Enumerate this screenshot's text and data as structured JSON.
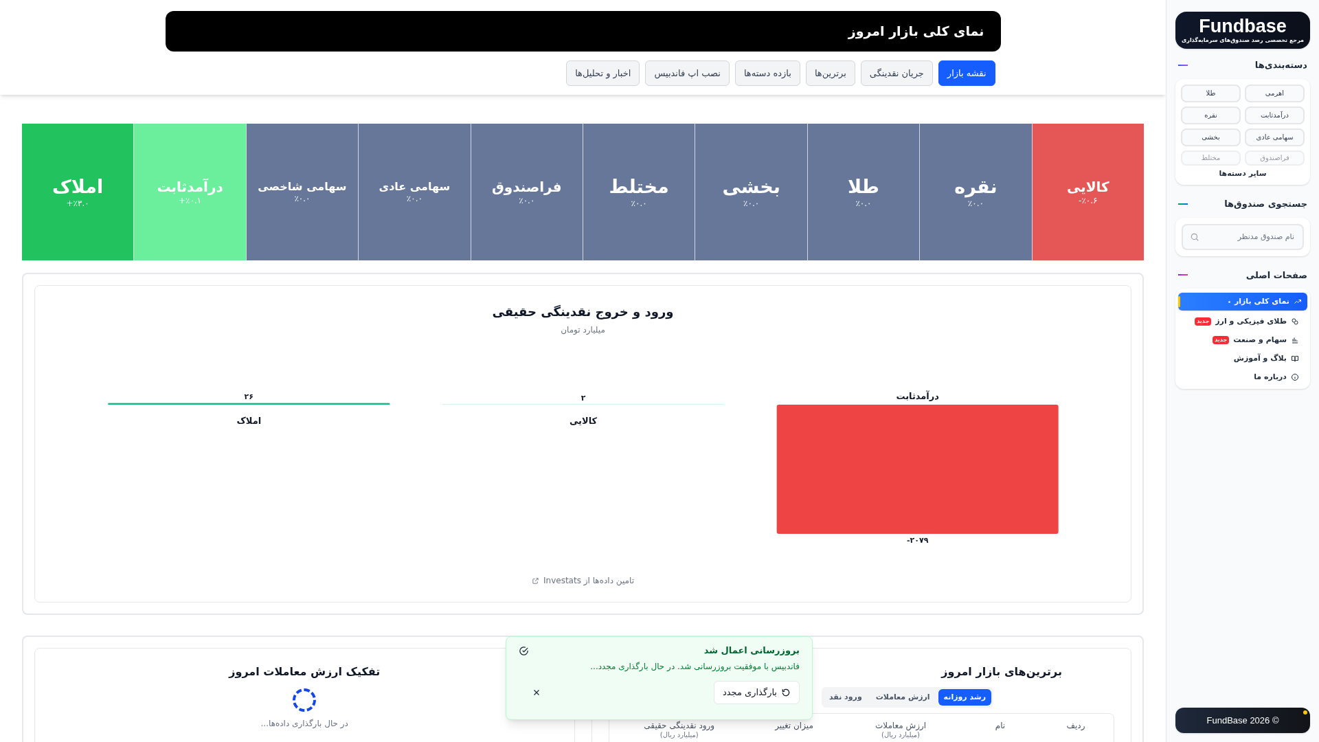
{
  "header": {
    "title": "نمای کلی بازار امروز",
    "tabs": [
      {
        "label": "نقشه بازار",
        "selected": true
      },
      {
        "label": "جریان نقدینگی",
        "selected": false
      },
      {
        "label": "برترین‌ها",
        "selected": false
      },
      {
        "label": "بازده دسته‌ها",
        "selected": false
      },
      {
        "label": "نصب اپ فاندبیس",
        "selected": false
      },
      {
        "label": "اخبار و تحلیل‌ها",
        "selected": false
      }
    ]
  },
  "market_map": [
    {
      "name": "کالایی",
      "change": "-٪۰.۶",
      "color": "#e55757"
    },
    {
      "name": "نقره",
      "change": "٪۰.۰",
      "color": "#667799"
    },
    {
      "name": "طلا",
      "change": "٪۰.۰",
      "color": "#667799"
    },
    {
      "name": "بخشی",
      "change": "٪۰.۰",
      "color": "#667799"
    },
    {
      "name": "مختلط",
      "change": "٪۰.۰",
      "color": "#667799"
    },
    {
      "name": "فراصندوق",
      "change": "٪۰.۰",
      "color": "#667799"
    },
    {
      "name": "سهامی عادی",
      "change": "٪۰.۰",
      "color": "#667799"
    },
    {
      "name": "سهامی شاخصی",
      "change": "٪۰.۰",
      "color": "#667799"
    },
    {
      "name": "درآمدثابت",
      "change": "+٪۰.۱",
      "color": "#6cef9c"
    },
    {
      "name": "املاک",
      "change": "+٪۳.۰",
      "color": "#22c35e"
    }
  ],
  "flow_chart": {
    "title": "ورود و خروج نقدینگی حقیقی",
    "subtitle": "میلیارد تومان",
    "chart_data": {
      "type": "bar",
      "categories": [
        "املاک",
        "کالایی",
        "درآمدثابت"
      ],
      "series": [
        {
          "color": "#10b981",
          "values": [
            26,
            2,
            null
          ],
          "value_labels": [
            "۲۶",
            "۲",
            null
          ]
        },
        {
          "color": "#ef4444",
          "values": [
            null,
            null,
            -2079
          ],
          "value_labels": [
            null,
            null,
            "-۲۰۷۹"
          ]
        }
      ]
    },
    "source": "تامین داده‌ها از Investats"
  },
  "trade_breakdown": {
    "title": "تفکیک ارزش معاملات امروز",
    "loading_text": "در حال بارگذاری داده‌ها..."
  },
  "top_funds": {
    "title": "برترین‌های بازار امروز",
    "tabs": [
      {
        "label": "رشد روزانه",
        "selected": true
      },
      {
        "label": "ارزش معاملات",
        "selected": false
      },
      {
        "label": "ورود نقد",
        "selected": false
      }
    ],
    "columns": [
      {
        "label": "ردیف"
      },
      {
        "label": "نام"
      },
      {
        "label": "ارزش معاملات",
        "unit": "(میلیارد ریال)"
      },
      {
        "label": "میزان تغییر"
      },
      {
        "label": "ورود نقدینگی حقیقی",
        "unit": "(میلیارد ریال)"
      }
    ]
  },
  "toast": {
    "title": "بروزرسانی اعمال شد",
    "message": "فاندبیس با موفقیت بروزرسانی شد. در حال بارگذاری مجدد...",
    "button": "بارگذاری مجدد"
  },
  "sidebar": {
    "logo": {
      "name": "Fundbase",
      "tagline": "مرجع تخصصی رصد صندوق‌های سرمایه‌گذاری"
    },
    "categories": {
      "title": "دسته‌بندی‌ها",
      "items": [
        "اهرمی",
        "طلا",
        "درآمدثابت",
        "نقره",
        "سهامی عادی",
        "بخشی"
      ],
      "faded_items": [
        "فراصندوق",
        "مختلط"
      ],
      "more": "سایر دسته‌ها"
    },
    "search": {
      "title": "جستجوی صندوق‌ها",
      "placeholder": "نام صندوق مدنظر"
    },
    "pages": {
      "title": "صفحات اصلی",
      "items": [
        {
          "label": "نمای کلی بازار",
          "selected": true
        },
        {
          "label": "طلای فیزیکی و ارز",
          "badge": "جدید",
          "selected": false
        },
        {
          "label": "سهام و صنعت",
          "badge": "جدید",
          "selected": false
        },
        {
          "label": "بلاگ و آموزش",
          "selected": false
        },
        {
          "label": "درباره ما",
          "selected": false
        }
      ]
    },
    "footer": "FundBase 2026 ©"
  }
}
